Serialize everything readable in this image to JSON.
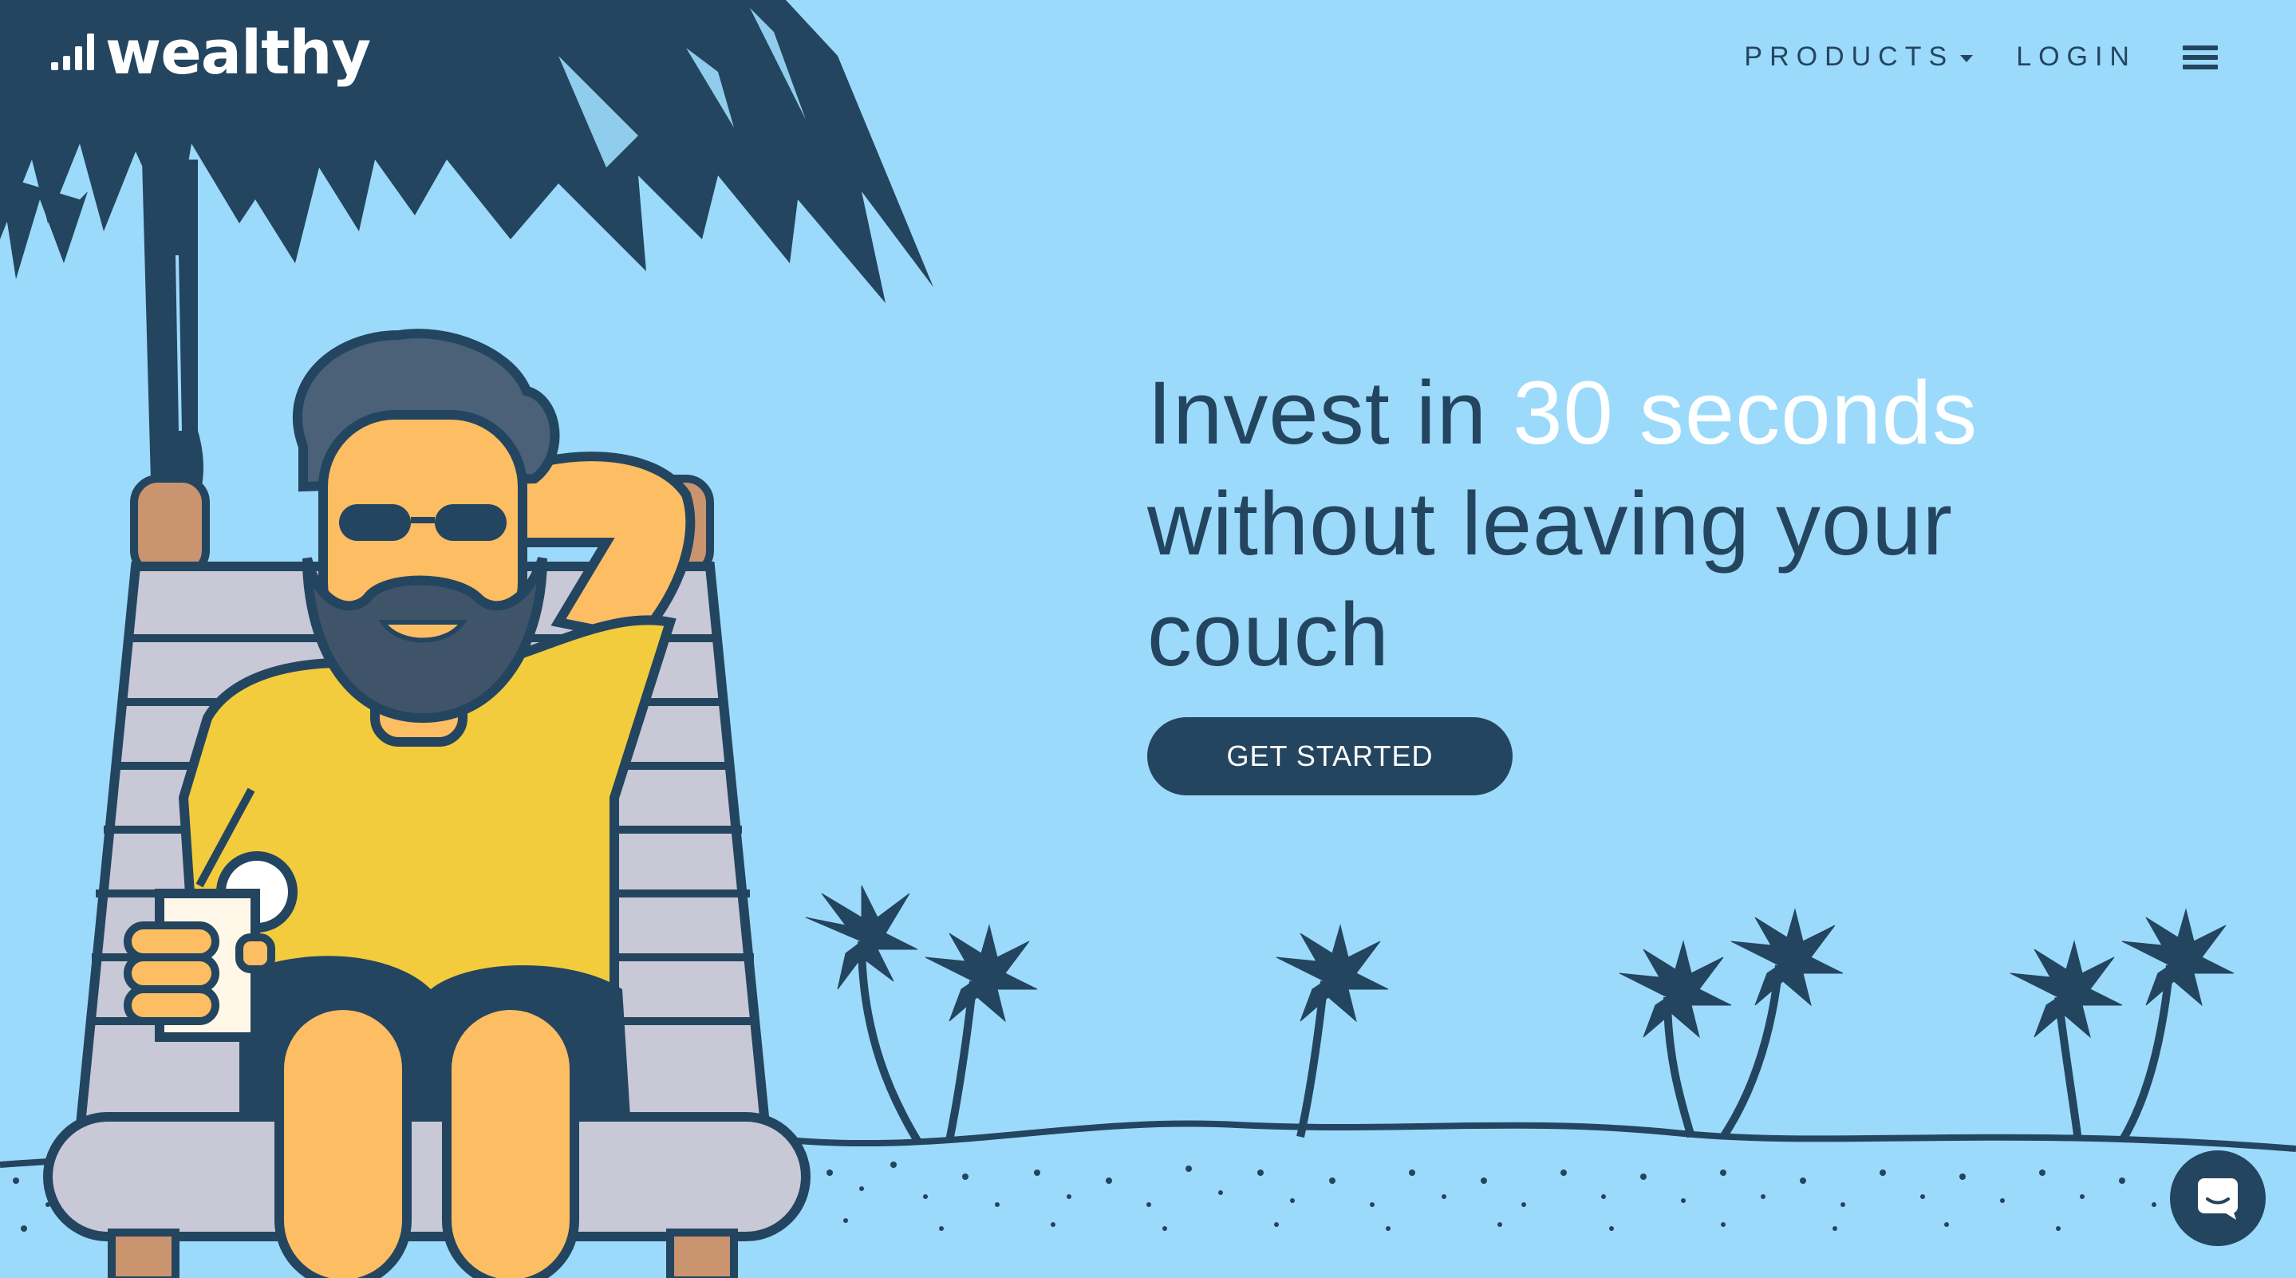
{
  "brand": {
    "logo_text": "wealthy",
    "accent_color": "#24455f",
    "background_color": "#9cdafb",
    "highlight_color": "#ffffff"
  },
  "nav": {
    "products_label": "PRODUCTS",
    "login_label": "LOGIN",
    "menu_icon": "hamburger-menu-icon"
  },
  "hero": {
    "title_part1": "Invest in ",
    "title_highlight": "30 seconds",
    "title_part2": "without leaving your",
    "title_part3": "couch",
    "cta_label": "GET STARTED"
  },
  "chat": {
    "icon": "chat-icon"
  }
}
